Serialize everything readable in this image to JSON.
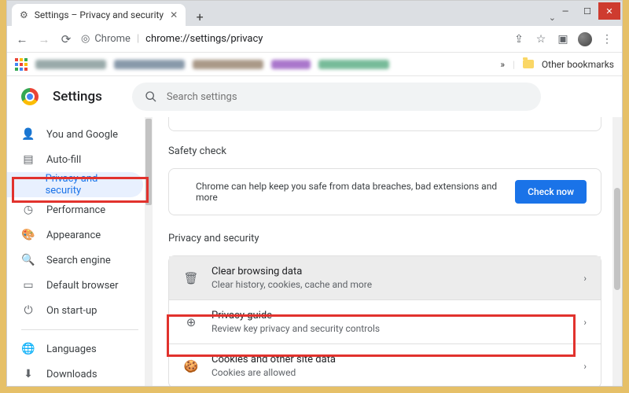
{
  "window": {
    "tab_title": "Settings – Privacy and security",
    "caret": "⌄"
  },
  "address": {
    "scheme_label": "Chrome",
    "url": "chrome://settings/privacy"
  },
  "bookmarks": {
    "overflow": "»",
    "other": "Other bookmarks"
  },
  "header": {
    "title": "Settings",
    "search_placeholder": "Search settings"
  },
  "sidebar": {
    "items": [
      {
        "icon": "person",
        "label": "You and Google"
      },
      {
        "icon": "autofill",
        "label": "Auto-fill"
      },
      {
        "icon": "shield",
        "label": "Privacy and security",
        "active": true
      },
      {
        "icon": "speed",
        "label": "Performance"
      },
      {
        "icon": "palette",
        "label": "Appearance"
      },
      {
        "icon": "search",
        "label": "Search engine"
      },
      {
        "icon": "browser",
        "label": "Default browser"
      },
      {
        "icon": "power",
        "label": "On start-up"
      }
    ],
    "more": [
      {
        "icon": "globe",
        "label": "Languages"
      },
      {
        "icon": "download",
        "label": "Downloads"
      }
    ]
  },
  "main": {
    "safety": {
      "heading": "Safety check",
      "text": "Chrome can help keep you safe from data breaches, bad extensions and more",
      "button": "Check now"
    },
    "privacy": {
      "heading": "Privacy and security",
      "rows": [
        {
          "title": "Clear browsing data",
          "sub": "Clear history, cookies, cache and more",
          "icon": "trash"
        },
        {
          "title": "Privacy guide",
          "sub": "Review key privacy and security controls",
          "icon": "compass"
        },
        {
          "title": "Cookies and other site data",
          "sub": "Cookies are allowed",
          "icon": "cookie"
        }
      ]
    }
  }
}
